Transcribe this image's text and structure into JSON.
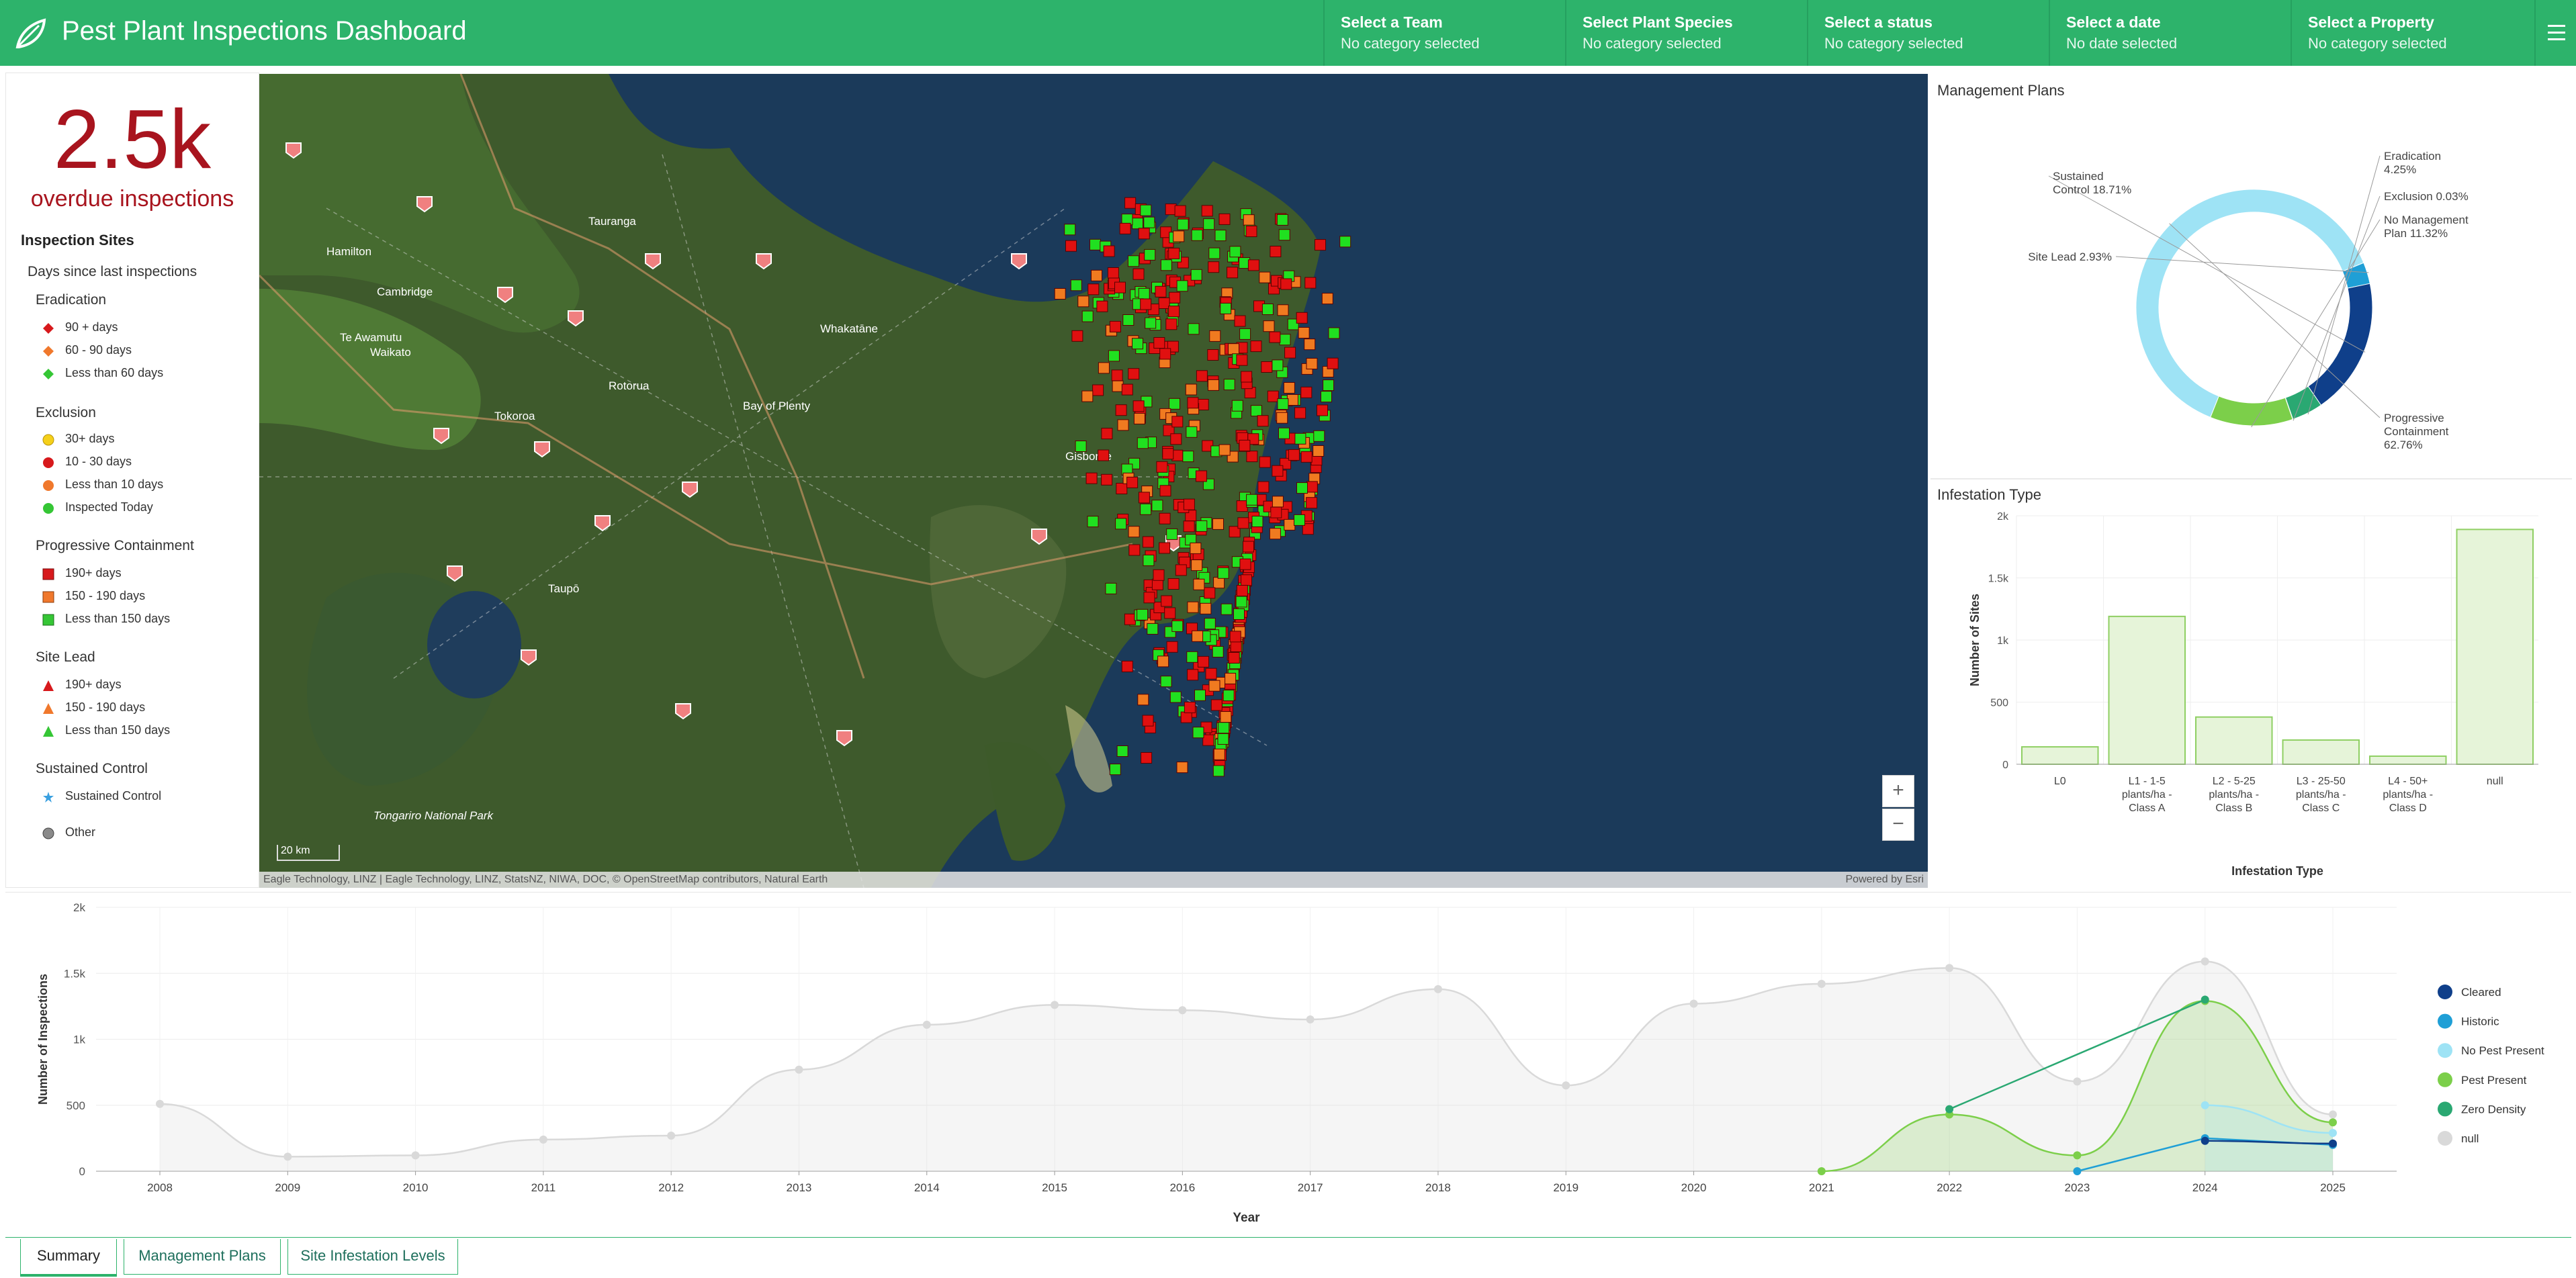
{
  "header": {
    "title": "Pest Plant Inspections Dashboard",
    "selectors": [
      {
        "title": "Select a Team",
        "value": "No category selected"
      },
      {
        "title": "Select Plant Species",
        "value": "No category selected"
      },
      {
        "title": "Select a status",
        "value": "No category selected"
      },
      {
        "title": "Select a date",
        "value": "No date selected"
      },
      {
        "title": "Select a Property",
        "value": "No category selected"
      }
    ]
  },
  "kpi": {
    "value": "2.5k",
    "label": "overdue inspections"
  },
  "legend": {
    "title": "Inspection Sites",
    "subtitle": "Days since last inspections",
    "groups": [
      {
        "name": "Eradication",
        "items": [
          {
            "label": "90 + days",
            "shape": "diamond",
            "color": "#d7191c"
          },
          {
            "label": "60 - 90 days",
            "shape": "diamond",
            "color": "#f0782c"
          },
          {
            "label": "Less than 60 days",
            "shape": "diamond",
            "color": "#35c635"
          }
        ]
      },
      {
        "name": "Exclusion",
        "items": [
          {
            "label": "30+ days",
            "shape": "circle",
            "color": "#f5d01a"
          },
          {
            "label": "10 - 30 days",
            "shape": "circle",
            "color": "#d7191c"
          },
          {
            "label": "Less than 10 days",
            "shape": "circle",
            "color": "#f0782c"
          },
          {
            "label": "Inspected Today",
            "shape": "circle",
            "color": "#35c635"
          }
        ]
      },
      {
        "name": "Progressive Containment",
        "items": [
          {
            "label": "190+ days",
            "shape": "square",
            "color": "#d7191c"
          },
          {
            "label": "150 - 190 days",
            "shape": "square",
            "color": "#f0782c"
          },
          {
            "label": "Less than 150 days",
            "shape": "square",
            "color": "#35c635"
          }
        ]
      },
      {
        "name": "Site Lead",
        "items": [
          {
            "label": "190+ days",
            "shape": "triangle",
            "color": "#d7191c"
          },
          {
            "label": "150 - 190 days",
            "shape": "triangle",
            "color": "#f0782c"
          },
          {
            "label": "Less than 150 days",
            "shape": "triangle",
            "color": "#35c635"
          }
        ]
      },
      {
        "name": "Sustained Control",
        "items": [
          {
            "label": "Sustained Control",
            "shape": "star",
            "color": "#3aa0e0"
          }
        ]
      }
    ],
    "other": {
      "label": "Other",
      "shape": "circle",
      "color": "#8a8a8a"
    }
  },
  "map": {
    "place_labels": [
      "Tauranga",
      "Hamilton",
      "Cambridge",
      "Te Awamutu",
      "Waikato",
      "Whakatāne",
      "Rotorua",
      "Bay of Plenty",
      "Tokoroa",
      "Gisborne",
      "Taupō",
      "Tongariro National Park"
    ],
    "attribution": "Eagle Technology, LINZ | Eagle Technology, LINZ, StatsNZ, NIWA, DOC, © OpenStreetMap contributors, Natural Earth",
    "powered_by": "Powered by Esri",
    "scale": "20 km",
    "zoom_in": "+",
    "zoom_out": "−"
  },
  "management_plans": {
    "title": "Management Plans",
    "chart_data": {
      "type": "pie",
      "slices": [
        {
          "label": "Progressive Containment",
          "value": 62.76,
          "color": "#9ee3f5"
        },
        {
          "label": "Site Lead",
          "value": 2.93,
          "color": "#1f9fd6"
        },
        {
          "label": "Sustained Control",
          "value": 18.71,
          "color": "#0f3f8a"
        },
        {
          "label": "Eradication",
          "value": 4.25,
          "color": "#2aa872"
        },
        {
          "label": "Exclusion",
          "value": 0.03,
          "color": "#1f7a3f"
        },
        {
          "label": "No Management Plan",
          "value": 11.32,
          "color": "#7ccf4a"
        }
      ],
      "slice_labels": [
        {
          "key": "Progressive Containment",
          "lines": [
            "Progressive",
            "Containment",
            "62.76%"
          ]
        },
        {
          "key": "Site Lead",
          "lines": [
            "Site Lead 2.93%"
          ]
        },
        {
          "key": "Sustained Control",
          "lines": [
            "Sustained",
            "Control 18.71%"
          ]
        },
        {
          "key": "Eradication",
          "lines": [
            "Eradication",
            "4.25%"
          ]
        },
        {
          "key": "Exclusion",
          "lines": [
            "Exclusion 0.03%"
          ]
        },
        {
          "key": "No Management Plan",
          "lines": [
            "No Management",
            "Plan 11.32%"
          ]
        }
      ]
    }
  },
  "infestation": {
    "title": "Infestation Type",
    "chart_data": {
      "type": "bar",
      "categories": [
        [
          "L0"
        ],
        [
          "L1 - 1-5",
          "plants/ha -",
          "Class A"
        ],
        [
          "L2 - 5-25",
          "plants/ha -",
          "Class B"
        ],
        [
          "L3 - 25-50",
          "plants/ha -",
          "Class C"
        ],
        [
          "L4 - 50+",
          "plants/ha -",
          "Class D"
        ],
        [
          "null"
        ]
      ],
      "values": [
        140,
        1190,
        380,
        195,
        65,
        1890
      ],
      "xlabel": "Infestation Type",
      "ylabel": "Number of Sites",
      "ylim": [
        0,
        2000
      ],
      "yticks": [
        0,
        500,
        1000,
        1500,
        2000
      ],
      "ytick_labels": [
        "0",
        "500",
        "1k",
        "1.5k",
        "2k"
      ],
      "bar_color": "#e6f4d9",
      "bar_stroke": "#8fcf63"
    }
  },
  "timeline": {
    "chart_data": {
      "type": "area",
      "x": [
        2008,
        2009,
        2010,
        2011,
        2012,
        2013,
        2014,
        2015,
        2016,
        2017,
        2018,
        2019,
        2020,
        2021,
        2022,
        2023,
        2024,
        2025
      ],
      "xlabel": "Year",
      "ylabel": "Number of Inspections",
      "ylim": [
        0,
        2000
      ],
      "yticks": [
        0,
        500,
        1000,
        1500,
        2000
      ],
      "ytick_labels": [
        "0",
        "500",
        "1k",
        "1.5k",
        "2k"
      ],
      "series": [
        {
          "name": "Cleared",
          "color": "#0f3f8a",
          "x": [
            2024,
            2025
          ],
          "values": [
            230,
            210
          ]
        },
        {
          "name": "Historic",
          "color": "#1f9fd6",
          "x": [
            2023,
            2024,
            2025
          ],
          "values": [
            0,
            250,
            200
          ]
        },
        {
          "name": "No Pest Present",
          "color": "#9ee3f5",
          "x": [
            2024,
            2025
          ],
          "values": [
            500,
            290
          ]
        },
        {
          "name": "Pest Present",
          "color": "#7ccf4a",
          "x": [
            2021,
            2022,
            2023,
            2024,
            2025
          ],
          "values": [
            0,
            430,
            120,
            1290,
            370
          ]
        },
        {
          "name": "Zero Density",
          "color": "#2aa872",
          "x": [
            2022,
            2024
          ],
          "values": [
            470,
            1300
          ]
        },
        {
          "name": "null",
          "color": "#d9d9d9",
          "x": [
            2008,
            2009,
            2010,
            2011,
            2012,
            2013,
            2014,
            2015,
            2016,
            2017,
            2018,
            2019,
            2020,
            2021,
            2022,
            2023,
            2024,
            2025
          ],
          "values": [
            510,
            110,
            120,
            240,
            270,
            770,
            1110,
            1260,
            1220,
            1150,
            1380,
            650,
            1270,
            1420,
            1540,
            680,
            1590,
            430
          ]
        }
      ],
      "legend_position": "right"
    }
  },
  "tabs": [
    {
      "label": "Summary",
      "active": true
    },
    {
      "label": "Management Plans",
      "active": false
    },
    {
      "label": "Site Infestation Levels",
      "active": false
    }
  ],
  "colors": {
    "brand": "#2db36b",
    "kpi": "#a8141e"
  },
  "icons": {
    "logo": "leaf-icon",
    "menu": "hamburger-menu-icon"
  }
}
